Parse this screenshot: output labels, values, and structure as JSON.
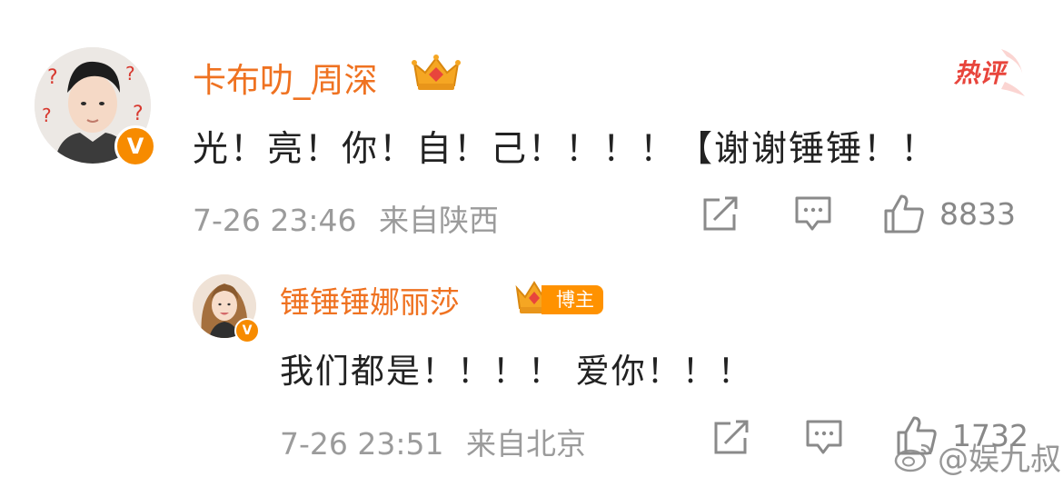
{
  "comment": {
    "username": "卡布叻_周深",
    "content": "光！亮！你！自！己！！！！【谢谢锤锤！！",
    "time": "7-26 23:46",
    "location": "来自陕西",
    "likes": "8833",
    "hot_label": "热评",
    "verified_badge": "V"
  },
  "reply": {
    "username": "锤锤锤娜丽莎",
    "author_tag": "博主",
    "content": "我们都是！！！！ 爱你！！！",
    "time": "7-26 23:51",
    "location": "来自北京",
    "likes": "1732",
    "verified_badge": "V"
  },
  "watermark": {
    "text": "@娱九叔"
  },
  "icons": [
    "crown-icon",
    "share-icon",
    "comment-icon",
    "like-icon",
    "weibo-logo-icon"
  ],
  "colors": {
    "username": "#ef7221",
    "text": "#222222",
    "meta": "#9b9b9b",
    "badge": "#f78b00",
    "hot": "#e8453c"
  }
}
